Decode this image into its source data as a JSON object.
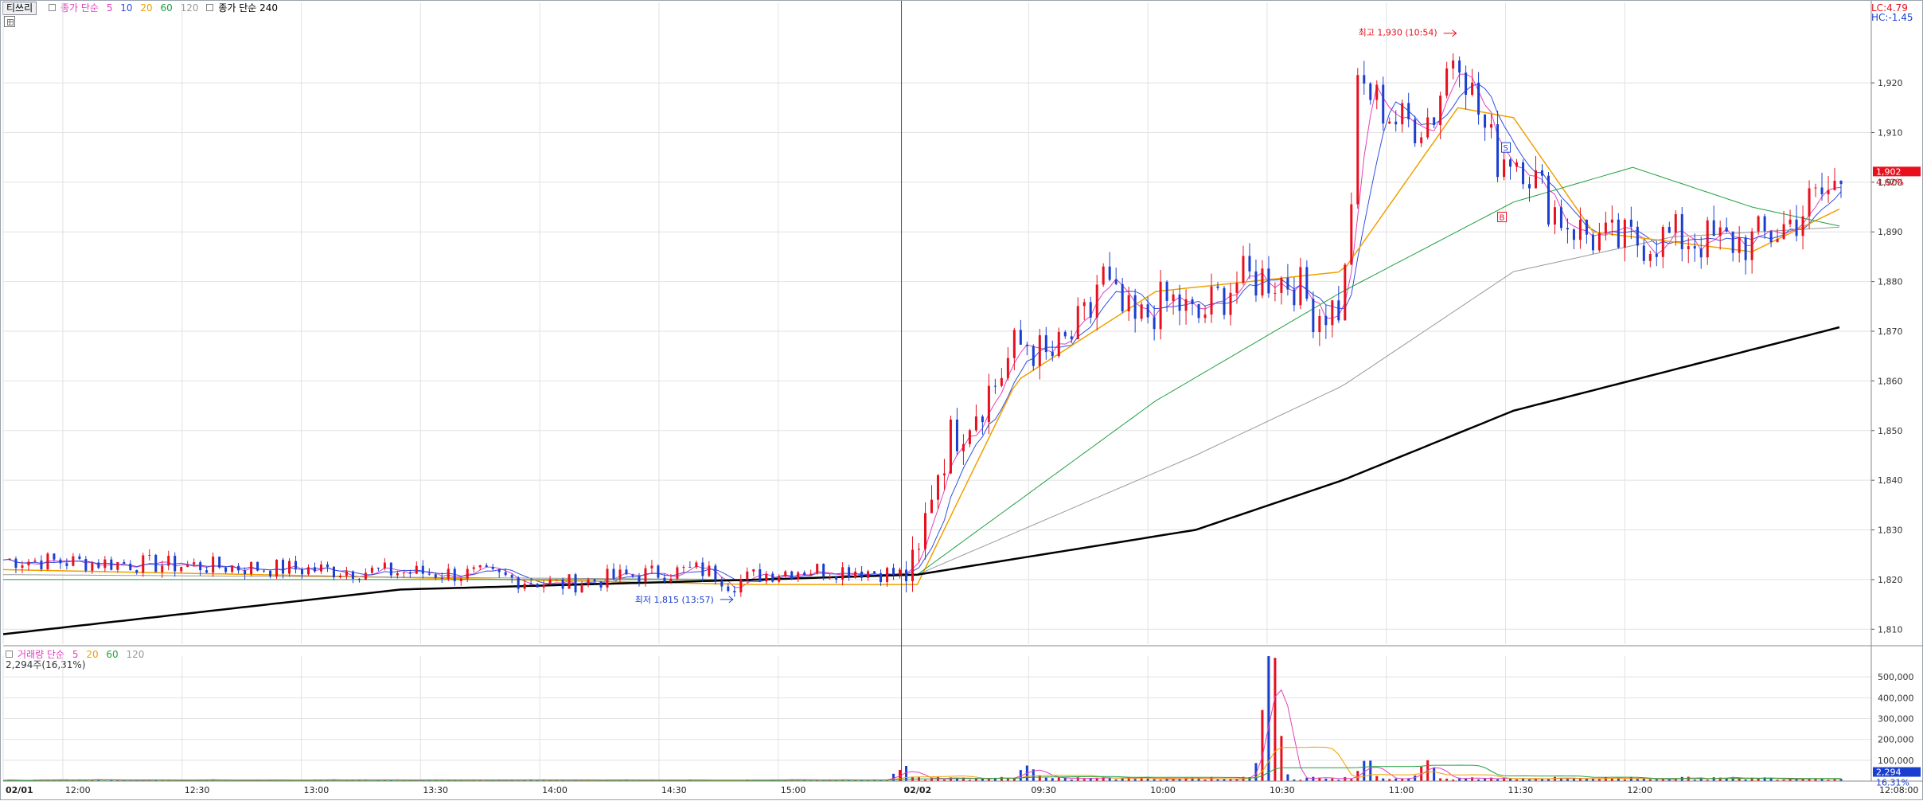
{
  "toolbar": {
    "tab_label": "티쓰리"
  },
  "price_legend": {
    "prefix": "종가 단순",
    "periods": [
      {
        "label": "5",
        "color": "#e040c0"
      },
      {
        "label": "10",
        "color": "#3050e0"
      },
      {
        "label": "20",
        "color": "#f0a000"
      },
      {
        "label": "60",
        "color": "#20a040"
      },
      {
        "label": "120",
        "color": "#999999"
      }
    ],
    "long_label": "종가 단순 240",
    "long_color": "#000000",
    "prefix_color": "#e040c0"
  },
  "volume_legend": {
    "prefix": "거래량 단순",
    "periods": [
      {
        "label": "5",
        "color": "#e040c0"
      },
      {
        "label": "20",
        "color": "#f0a000"
      },
      {
        "label": "60",
        "color": "#20a040"
      },
      {
        "label": "120",
        "color": "#999999"
      }
    ],
    "prefix_color": "#e040c0",
    "summary": "2,294주(16,31%)"
  },
  "indicators": {
    "lc": "LC:4.79",
    "hc": "HC:-1.45"
  },
  "current_price": {
    "value": "1,902",
    "change": "4.62%"
  },
  "current_volume": {
    "value": "2,294",
    "ratio": "16.31%"
  },
  "annotations": {
    "high": "최고 1,930 (10:54)",
    "low": "최저 1,815 (13:57)",
    "marker_s": "S",
    "marker_b": "B"
  },
  "colors": {
    "up": "#e8101c",
    "down": "#1a3fd0",
    "grid": "#e2e2e2",
    "ma5": "#e040c0",
    "ma10": "#3050e0",
    "ma20": "#f0a000",
    "ma60": "#20a040",
    "ma120": "#999999",
    "ma240": "#000000",
    "divider": "#e8101c"
  },
  "chart_data": {
    "type": "candlestick",
    "price_axis": {
      "min": 1810,
      "max": 1930,
      "ticks": [
        "1,810",
        "1,820",
        "1,830",
        "1,840",
        "1,850",
        "1,860",
        "1,870",
        "1,880",
        "1,890",
        "1,900",
        "1,910",
        "1,920"
      ]
    },
    "volume_axis": {
      "max": 500000,
      "ticks": [
        "100,000",
        "200,000",
        "300,000",
        "400,000",
        "500,000"
      ]
    },
    "time_ticks": [
      "02/01",
      "12:00",
      "12:30",
      "13:00",
      "13:30",
      "14:00",
      "14:30",
      "15:00",
      "02/02",
      "09:30",
      "10:00",
      "10:30",
      "11:00",
      "11:30",
      "12:00"
    ],
    "last_time_label": "12:08:00",
    "session_boundary_label": "02/02",
    "price_path": [
      [
        0,
        1824
      ],
      [
        40,
        1823
      ],
      [
        80,
        1822
      ],
      [
        120,
        1821
      ],
      [
        140,
        1819
      ],
      [
        160,
        1821
      ],
      [
        175,
        1822
      ],
      [
        180,
        1821
      ],
      [
        183,
        1819
      ],
      [
        186,
        1820
      ],
      [
        190,
        1821
      ],
      [
        200,
        1822
      ],
      [
        215,
        1822
      ],
      [
        226,
        1821
      ],
      [
        230,
        1822
      ],
      [
        232,
        1832
      ],
      [
        234,
        1840
      ],
      [
        238,
        1848
      ],
      [
        242,
        1852
      ],
      [
        246,
        1856
      ],
      [
        250,
        1860
      ],
      [
        254,
        1866
      ],
      [
        258,
        1868
      ],
      [
        262,
        1864
      ],
      [
        266,
        1866
      ],
      [
        270,
        1870
      ],
      [
        274,
        1874
      ],
      [
        276,
        1883
      ],
      [
        278,
        1878
      ],
      [
        281,
        1874
      ],
      [
        285,
        1871
      ],
      [
        290,
        1875
      ],
      [
        295,
        1876
      ],
      [
        300,
        1872
      ],
      [
        305,
        1876
      ],
      [
        310,
        1880
      ],
      [
        318,
        1881
      ],
      [
        325,
        1880
      ],
      [
        330,
        1874
      ],
      [
        337,
        1875
      ],
      [
        339,
        1895
      ],
      [
        341,
        1920
      ],
      [
        346,
        1916
      ],
      [
        351,
        1912
      ],
      [
        356,
        1912
      ],
      [
        360,
        1914
      ],
      [
        364,
        1925
      ],
      [
        366,
        1928
      ],
      [
        369,
        1919
      ],
      [
        373,
        1910
      ],
      [
        376,
        1905
      ],
      [
        379,
        1906
      ],
      [
        383,
        1904
      ],
      [
        387,
        1898
      ],
      [
        392,
        1893
      ],
      [
        397,
        1890
      ],
      [
        403,
        1888
      ],
      [
        410,
        1888
      ],
      [
        420,
        1889
      ],
      [
        430,
        1888
      ],
      [
        440,
        1888
      ],
      [
        446,
        1890
      ],
      [
        450,
        1892
      ],
      [
        455,
        1896
      ],
      [
        459,
        1898
      ],
      [
        462,
        1900
      ],
      [
        463,
        1902
      ]
    ],
    "price_path_x_note": "minutes since 11:30 of 02/01 session (session break compressed)",
    "ma240_path": [
      [
        0,
        1809
      ],
      [
        100,
        1818
      ],
      [
        190,
        1820
      ],
      [
        230,
        1821
      ],
      [
        300,
        1830
      ],
      [
        337,
        1840
      ],
      [
        380,
        1854
      ],
      [
        463,
        1871
      ]
    ],
    "ma120_path": [
      [
        0,
        1821
      ],
      [
        190,
        1820
      ],
      [
        230,
        1821
      ],
      [
        300,
        1845
      ],
      [
        337,
        1859
      ],
      [
        380,
        1882
      ],
      [
        420,
        1889
      ],
      [
        463,
        1891
      ]
    ],
    "ma60_path": [
      [
        0,
        1820
      ],
      [
        190,
        1820
      ],
      [
        230,
        1821
      ],
      [
        290,
        1856
      ],
      [
        337,
        1878
      ],
      [
        380,
        1896
      ],
      [
        410,
        1903
      ],
      [
        440,
        1895
      ],
      [
        463,
        1891
      ]
    ],
    "ma20_path": [
      [
        0,
        1822
      ],
      [
        190,
        1819
      ],
      [
        230,
        1819
      ],
      [
        255,
        1860
      ],
      [
        290,
        1878
      ],
      [
        337,
        1882
      ],
      [
        366,
        1915
      ],
      [
        380,
        1913
      ],
      [
        400,
        1890
      ],
      [
        440,
        1886
      ],
      [
        463,
        1895
      ]
    ],
    "volume_bars_note": "volume spikes around 09:40 (~90,000), 10:30 (~560,000), 10:55 (~150,000)",
    "volume_peaks": [
      {
        "time": "02/02 09:00",
        "volume": 95000
      },
      {
        "time": "02/02 09:40",
        "volume": 110000
      },
      {
        "time": "02/02 10:30",
        "volume": 560000
      },
      {
        "time": "02/02 10:31",
        "volume": 410000
      },
      {
        "time": "02/02 10:32",
        "volume": 320000
      },
      {
        "time": "02/02 10:55",
        "volume": 140000
      },
      {
        "time": "02/02 11:10",
        "volume": 130000
      }
    ]
  }
}
